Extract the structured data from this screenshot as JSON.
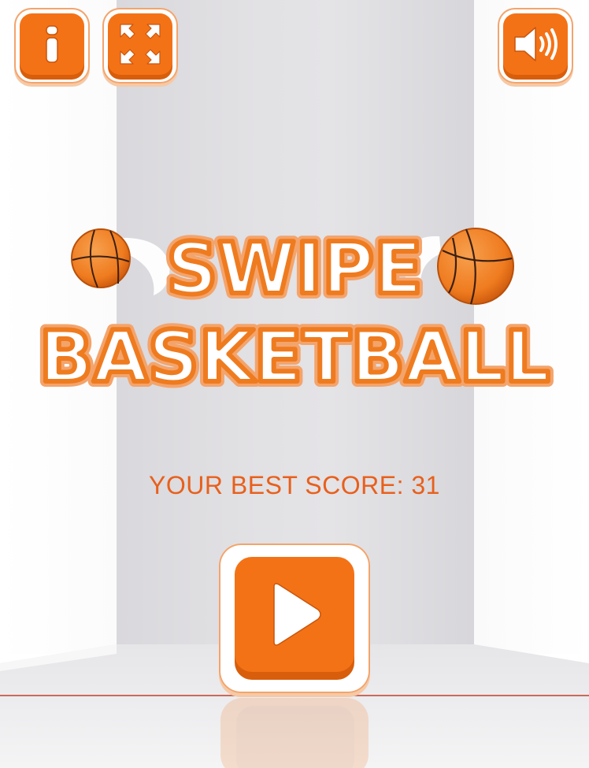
{
  "game": {
    "title_line1": "SWIPE",
    "title_line2": "BASKETBALL",
    "best_score_label": "YOUR BEST SCORE:",
    "best_score_value": "31"
  },
  "toolbar": {
    "info_icon": "info-icon",
    "fullscreen_icon": "fullscreen-icon",
    "sound_icon": "speaker-icon"
  },
  "colors": {
    "accent": "#f47216",
    "accent_dark": "#d85e0b",
    "accent_light": "#f3a46c",
    "text": "#e8601c",
    "court_line": "#c96a5a"
  }
}
